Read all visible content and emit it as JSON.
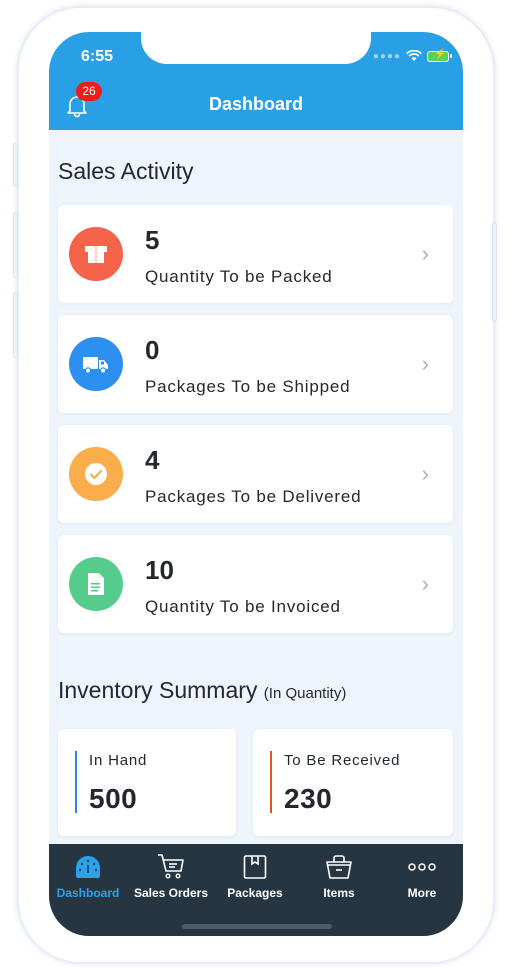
{
  "status_bar": {
    "time": "6:55",
    "signal": "signal-dots-icon",
    "wifi": "wifi-icon",
    "battery": "battery-charging-icon"
  },
  "header": {
    "title": "Dashboard",
    "notification_count": "26",
    "notification_icon": "bell-icon"
  },
  "sales_activity": {
    "title": "Sales Activity",
    "items": [
      {
        "value": "5",
        "label": "Quantity To be Packed",
        "icon": "box-icon",
        "color": "#f4634a"
      },
      {
        "value": "0",
        "label": "Packages To be Shipped",
        "icon": "truck-icon",
        "color": "#2d8ff0"
      },
      {
        "value": "4",
        "label": "Packages To be Delivered",
        "icon": "check-circle-icon",
        "color": "#fbad4c"
      },
      {
        "value": "10",
        "label": "Quantity To be Invoiced",
        "icon": "document-icon",
        "color": "#55cc8c"
      }
    ]
  },
  "inventory_summary": {
    "title": "Inventory Summary",
    "subtitle": "(In Quantity)",
    "cards": [
      {
        "label": "In Hand",
        "value": "500",
        "accent": "#2d86ef"
      },
      {
        "label": "To Be Received",
        "value": "230",
        "accent": "#e4561f"
      }
    ]
  },
  "tabbar": {
    "active_color": "#2aa2ee",
    "tabs": [
      {
        "label": "Dashboard",
        "icon": "gauge-icon",
        "active": true
      },
      {
        "label": "Sales Orders",
        "icon": "cart-icon",
        "active": false
      },
      {
        "label": "Packages",
        "icon": "package-icon",
        "active": false
      },
      {
        "label": "Items",
        "icon": "basket-icon",
        "active": false
      },
      {
        "label": "More",
        "icon": "more-icon",
        "active": false
      }
    ]
  }
}
